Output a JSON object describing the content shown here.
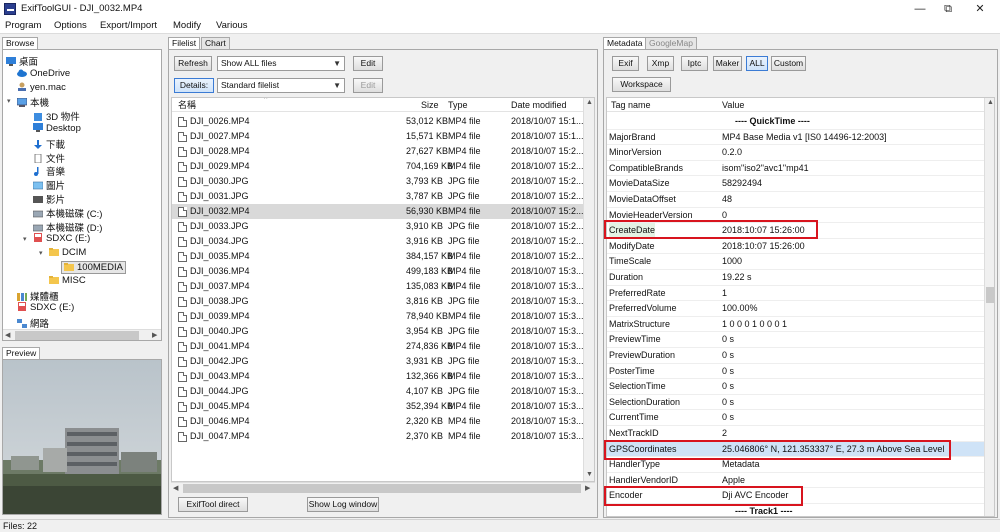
{
  "window": {
    "title": "ExifToolGUI - DJI_0032.MP4",
    "controls": {
      "minimize": "—",
      "restore": "⧉",
      "close": "✕"
    }
  },
  "menu": [
    "Program",
    "Options",
    "Export/Import",
    "Modify",
    "Various"
  ],
  "left": {
    "tab_browse": "Browse",
    "tree": [
      {
        "label": "桌面",
        "icon": "desktop-icon"
      },
      {
        "label": "OneDrive",
        "icon": "cloud-icon"
      },
      {
        "label": "yen.mac",
        "icon": "user-icon"
      },
      {
        "label": "本機",
        "icon": "computer-icon"
      },
      {
        "label": "3D 物件",
        "icon": "cube-icon"
      },
      {
        "label": "Desktop",
        "icon": "desktop-icon"
      },
      {
        "label": "下載",
        "icon": "download-icon"
      },
      {
        "label": "文件",
        "icon": "document-icon"
      },
      {
        "label": "音樂",
        "icon": "music-icon"
      },
      {
        "label": "圖片",
        "icon": "image-icon"
      },
      {
        "label": "影片",
        "icon": "video-icon"
      },
      {
        "label": "本機磁碟 (C:)",
        "icon": "drive-icon"
      },
      {
        "label": "本機磁碟 (D:)",
        "icon": "drive-icon"
      },
      {
        "label": "SDXC (E:)",
        "icon": "sd-card-icon"
      },
      {
        "label": "DCIM",
        "icon": "folder-icon"
      },
      {
        "label": "100MEDIA",
        "icon": "folder-icon"
      },
      {
        "label": "MISC",
        "icon": "folder-icon"
      },
      {
        "label": "媒體櫃",
        "icon": "library-icon"
      },
      {
        "label": "SDXC (E:)",
        "icon": "sd-card-icon"
      },
      {
        "label": "網路",
        "icon": "network-icon"
      }
    ],
    "preview_label": "Preview"
  },
  "middle": {
    "tab_filelist": "Filelist",
    "tab_chart": "Chart",
    "refresh": "Refresh",
    "filter_value": "Show ALL files",
    "edit1": "Edit",
    "details": "Details:",
    "view_value": "Standard filelist",
    "edit2": "Edit",
    "columns": [
      "名稱",
      "Size",
      "Type",
      "Date modified"
    ],
    "files": [
      {
        "name": "DJI_0026.MP4",
        "size": "53,012 KB",
        "type": "MP4 file",
        "date": "2018/10/07 15:1..."
      },
      {
        "name": "DJI_0027.MP4",
        "size": "15,571 KB",
        "type": "MP4 file",
        "date": "2018/10/07 15:1..."
      },
      {
        "name": "DJI_0028.MP4",
        "size": "27,627 KB",
        "type": "MP4 file",
        "date": "2018/10/07 15:2..."
      },
      {
        "name": "DJI_0029.MP4",
        "size": "704,169 KB",
        "type": "MP4 file",
        "date": "2018/10/07 15:2..."
      },
      {
        "name": "DJI_0030.JPG",
        "size": "3,793 KB",
        "type": "JPG file",
        "date": "2018/10/07 15:2..."
      },
      {
        "name": "DJI_0031.JPG",
        "size": "3,787 KB",
        "type": "JPG file",
        "date": "2018/10/07 15:2..."
      },
      {
        "name": "DJI_0032.MP4",
        "size": "56,930 KB",
        "type": "MP4 file",
        "date": "2018/10/07 15:2..."
      },
      {
        "name": "DJI_0033.JPG",
        "size": "3,910 KB",
        "type": "JPG file",
        "date": "2018/10/07 15:2..."
      },
      {
        "name": "DJI_0034.JPG",
        "size": "3,916 KB",
        "type": "JPG file",
        "date": "2018/10/07 15:2..."
      },
      {
        "name": "DJI_0035.MP4",
        "size": "384,157 KB",
        "type": "MP4 file",
        "date": "2018/10/07 15:2..."
      },
      {
        "name": "DJI_0036.MP4",
        "size": "499,183 KB",
        "type": "MP4 file",
        "date": "2018/10/07 15:3..."
      },
      {
        "name": "DJI_0037.MP4",
        "size": "135,083 KB",
        "type": "MP4 file",
        "date": "2018/10/07 15:3..."
      },
      {
        "name": "DJI_0038.JPG",
        "size": "3,816 KB",
        "type": "JPG file",
        "date": "2018/10/07 15:3..."
      },
      {
        "name": "DJI_0039.MP4",
        "size": "78,940 KB",
        "type": "MP4 file",
        "date": "2018/10/07 15:3..."
      },
      {
        "name": "DJI_0040.JPG",
        "size": "3,954 KB",
        "type": "JPG file",
        "date": "2018/10/07 15:3..."
      },
      {
        "name": "DJI_0041.MP4",
        "size": "274,836 KB",
        "type": "MP4 file",
        "date": "2018/10/07 15:3..."
      },
      {
        "name": "DJI_0042.JPG",
        "size": "3,931 KB",
        "type": "JPG file",
        "date": "2018/10/07 15:3..."
      },
      {
        "name": "DJI_0043.MP4",
        "size": "132,366 KB",
        "type": "MP4 file",
        "date": "2018/10/07 15:3..."
      },
      {
        "name": "DJI_0044.JPG",
        "size": "4,107 KB",
        "type": "JPG file",
        "date": "2018/10/07 15:3..."
      },
      {
        "name": "DJI_0045.MP4",
        "size": "352,394 KB",
        "type": "MP4 file",
        "date": "2018/10/07 15:3..."
      },
      {
        "name": "DJI_0046.MP4",
        "size": "2,320 KB",
        "type": "MP4 file",
        "date": "2018/10/07 15:3..."
      },
      {
        "name": "DJI_0047.MP4",
        "size": "2,370 KB",
        "type": "MP4 file",
        "date": "2018/10/07 15:3..."
      }
    ],
    "exiftool_direct": "ExifTool direct",
    "show_log": "Show Log window"
  },
  "right": {
    "tab_metadata": "Metadata",
    "tab_googlemap": "GoogleMap",
    "filters": [
      "Exif",
      "Xmp",
      "Iptc",
      "Maker",
      "ALL",
      "Custom"
    ],
    "workspace": "Workspace",
    "col_tag": "Tag name",
    "col_value": "Value",
    "rows": [
      {
        "k": "",
        "v": "---- QuickTime ----"
      },
      {
        "k": "MajorBrand",
        "v": "MP4 Base Media v1 [IS0 14496-12:2003]"
      },
      {
        "k": "MinorVersion",
        "v": "0.2.0"
      },
      {
        "k": "CompatibleBrands",
        "v": "isom\"iso2\"avc1\"mp41"
      },
      {
        "k": "MovieDataSize",
        "v": "58292494"
      },
      {
        "k": "MovieDataOffset",
        "v": "48"
      },
      {
        "k": "MovieHeaderVersion",
        "v": "0"
      },
      {
        "k": "CreateDate",
        "v": "2018:10:07 15:26:00"
      },
      {
        "k": "ModifyDate",
        "v": "2018:10:07 15:26:00"
      },
      {
        "k": "TimeScale",
        "v": "1000"
      },
      {
        "k": "Duration",
        "v": "19.22 s"
      },
      {
        "k": "PreferredRate",
        "v": "1"
      },
      {
        "k": "PreferredVolume",
        "v": "100.00%"
      },
      {
        "k": "MatrixStructure",
        "v": "1 0 0 0 1 0 0 0 1"
      },
      {
        "k": "PreviewTime",
        "v": "0 s"
      },
      {
        "k": "PreviewDuration",
        "v": "0 s"
      },
      {
        "k": "PosterTime",
        "v": "0 s"
      },
      {
        "k": "SelectionTime",
        "v": "0 s"
      },
      {
        "k": "SelectionDuration",
        "v": "0 s"
      },
      {
        "k": "CurrentTime",
        "v": "0 s"
      },
      {
        "k": "NextTrackID",
        "v": "2"
      },
      {
        "k": "GPSCoordinates",
        "v": "25.046806° N, 121.353337° E, 27.3 m Above Sea Level"
      },
      {
        "k": "HandlerType",
        "v": "Metadata"
      },
      {
        "k": "HandlerVendorID",
        "v": "Apple"
      },
      {
        "k": "Encoder",
        "v": "Dji AVC Encoder"
      },
      {
        "k": "",
        "v": "---- Track1 ----"
      }
    ]
  },
  "status": {
    "files": "Files: 22"
  }
}
